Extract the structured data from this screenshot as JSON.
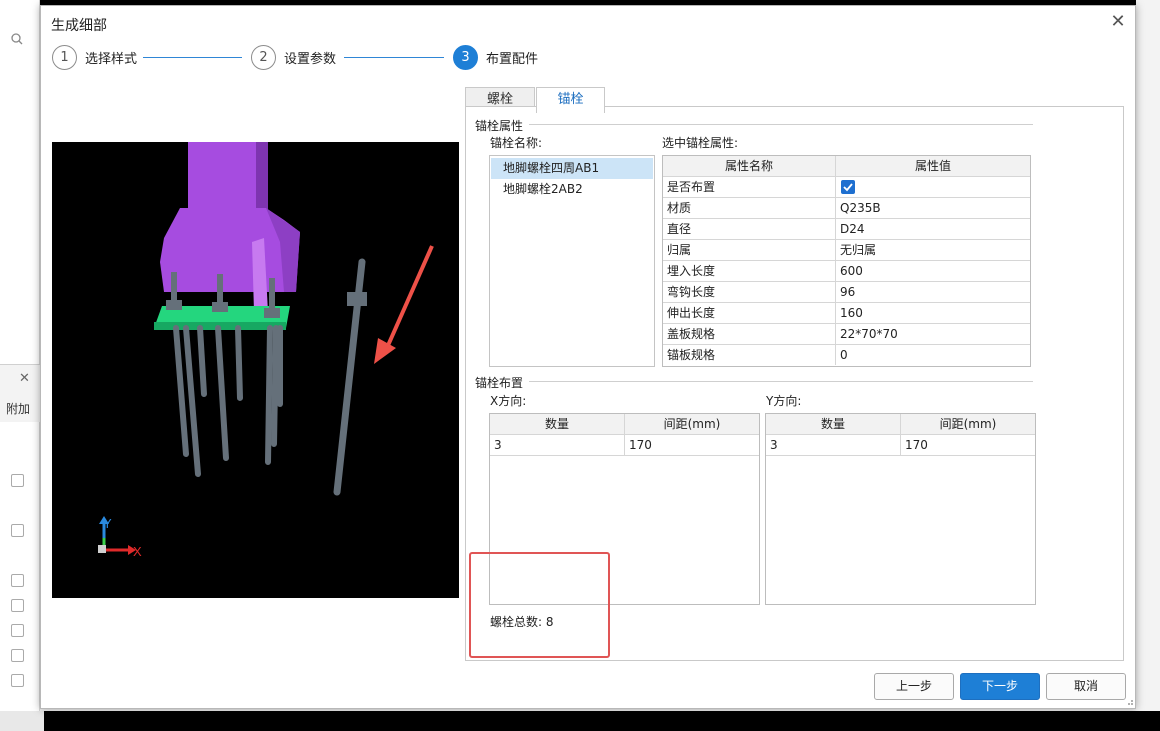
{
  "background": {
    "attach_label": "附加"
  },
  "dialog": {
    "title": "生成细部"
  },
  "wizard": {
    "steps": [
      {
        "number": "1",
        "label": "选择样式"
      },
      {
        "number": "2",
        "label": "设置参数"
      },
      {
        "number": "3",
        "label": "布置配件"
      }
    ],
    "active_step": 3
  },
  "tabs": [
    {
      "label": "螺栓"
    },
    {
      "label": "锚栓"
    }
  ],
  "active_tab": 1,
  "anchor_props": {
    "section_title": "锚栓属性",
    "name_label": "锚栓名称:",
    "selected_label": "选中锚栓属性:",
    "names": [
      "地脚螺栓四周AB1",
      "地脚螺栓2AB2"
    ],
    "selected_index": 0,
    "table": {
      "headers": [
        "属性名称",
        "属性值"
      ],
      "rows": [
        {
          "name": "是否布置",
          "value": "",
          "checked": true
        },
        {
          "name": "材质",
          "value": "Q235B"
        },
        {
          "name": "直径",
          "value": "D24"
        },
        {
          "name": "归属",
          "value": "无归属"
        },
        {
          "name": "埋入长度",
          "value": "600"
        },
        {
          "name": "弯钩长度",
          "value": "96"
        },
        {
          "name": "伸出长度",
          "value": "160"
        },
        {
          "name": "盖板规格",
          "value": "22*70*70"
        },
        {
          "name": "锚板规格",
          "value": "0"
        }
      ]
    }
  },
  "layout_section": {
    "section_title": "锚栓布置",
    "x_label": "X方向:",
    "y_label": "Y方向:",
    "headers": [
      "数量",
      "间距(mm)"
    ],
    "x_rows": [
      {
        "count": "3",
        "spacing": "170"
      }
    ],
    "y_rows": [
      {
        "count": "3",
        "spacing": "170"
      }
    ]
  },
  "summary": {
    "total_label": "螺栓总数:",
    "total_value": "8"
  },
  "buttons": {
    "prev": "上一步",
    "next": "下一步",
    "cancel": "取消"
  },
  "preview": {
    "axis_x": "X",
    "axis_y": "Y",
    "colors": {
      "column": "#a64ce0",
      "plate": "#24d67e",
      "bolt": "#65707a",
      "arrow": "#ee5148"
    }
  },
  "colors": {
    "accent": "#1e7fd6",
    "highlight": "#e05555"
  }
}
